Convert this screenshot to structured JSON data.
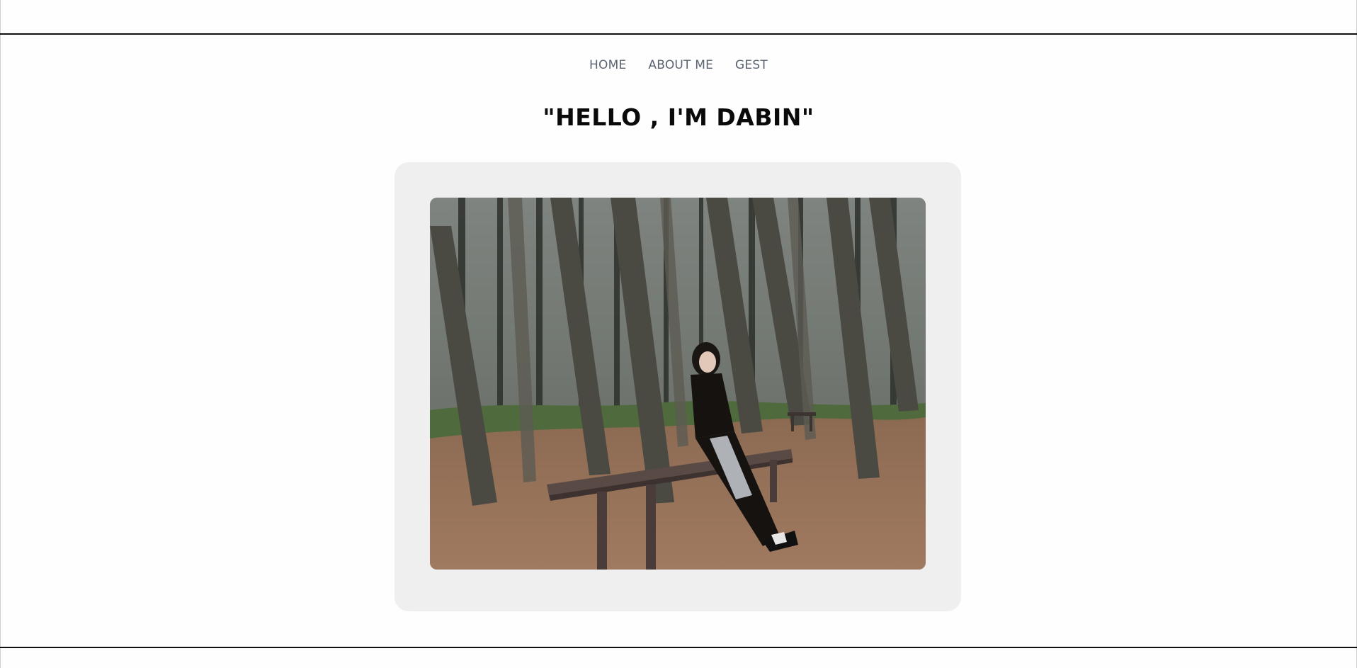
{
  "nav": {
    "items": [
      {
        "label": "HOME"
      },
      {
        "label": "ABOUT ME"
      },
      {
        "label": "GEST"
      }
    ]
  },
  "hero": {
    "title": "\"HELLO , I'M DABIN\""
  },
  "colors": {
    "nav_text": "#5b6472",
    "title_text": "#0a0a0a",
    "card_bg": "#efefef",
    "rule": "#111111"
  },
  "photo": {
    "alt": "woman sitting on a wooden bench in a pine forest"
  }
}
